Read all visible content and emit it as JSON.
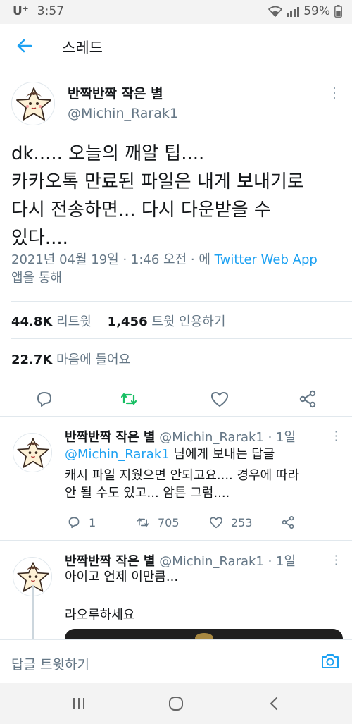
{
  "status_bar": {
    "carrier": "U⁺",
    "time": "3:57",
    "battery": "59%"
  },
  "header": {
    "title": "스레드"
  },
  "tweet": {
    "author_name": "반짝반짝 작은 별",
    "author_handle": "@Michin_Rarak1",
    "text_lines": [
      "dk..... 오늘의 깨알 팁....",
      "카카오톡 만료된 파일은 내게 보내기로",
      "다시 전송하면... 다시 다운받을 수",
      "있다...."
    ],
    "meta_prefix": "2021년 04월 19일 · 1:46 오전 · 에 ",
    "meta_app": "Twitter Web App",
    "meta_suffix": "앱을 통해",
    "retweets_count": "44.8K",
    "retweets_label": "리트윗",
    "quotes_count": "1,456",
    "quotes_label": "트윗 인용하기",
    "likes_count": "22.7K",
    "likes_label": "마음에 들어요"
  },
  "replies": [
    {
      "author_name": "반짝반짝 작은 별",
      "author_handle": "@Michin_Rarak1 · 1일",
      "replying_to": "@Michin_Rarak1",
      "replying_suffix": " 님에게 보내는 답글",
      "text_line1": "캐시 파일 지웠으면 안되고요.... 경우에 따라",
      "text_line2": "안 될 수도 있고... 암튼 그럼....",
      "reply_count": "1",
      "retweet_count": "705",
      "like_count": "253"
    },
    {
      "author_name": "반짝반짝 작은 별",
      "author_handle": "@Michin_Rarak1 · 1일",
      "text_line1": "아이고 언제 이만큼...",
      "text_line2": "라오루하세요"
    }
  ],
  "compose": {
    "placeholder": "답글 트윗하기"
  },
  "colors": {
    "accent": "#1da1f2",
    "retweet_green": "#17bf63",
    "secondary_text": "#657786"
  }
}
